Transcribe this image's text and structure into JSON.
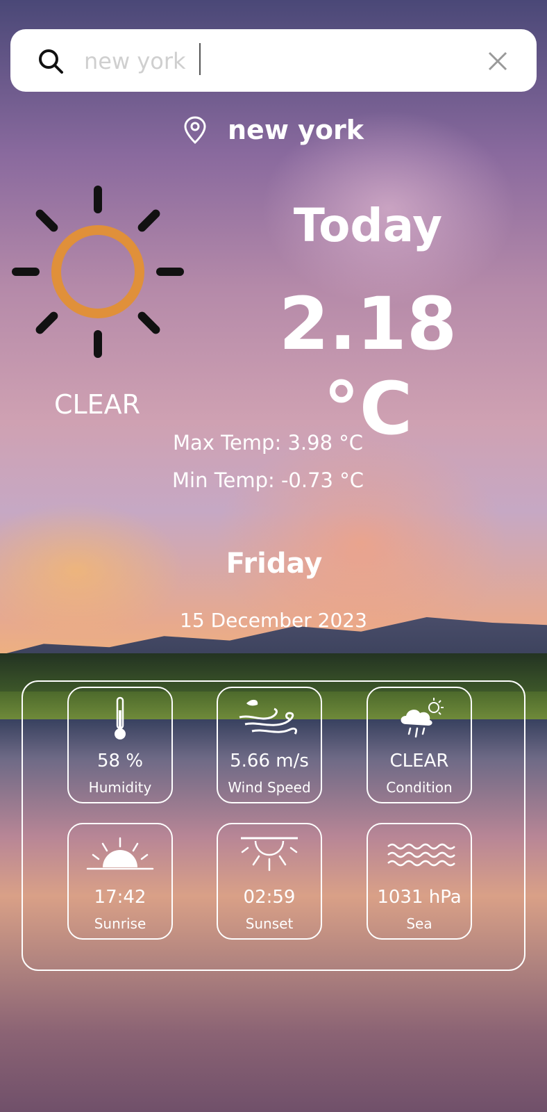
{
  "search": {
    "value": "new york"
  },
  "location": {
    "city": "new york"
  },
  "current": {
    "condition": "CLEAR",
    "heading": "Today",
    "temperature": "2.18 °C",
    "max_temp": "Max Temp: 3.98 °C",
    "min_temp": "Min Temp: -0.73 °C",
    "day": "Friday",
    "date": "15 December 2023"
  },
  "details": [
    {
      "icon": "thermometer-icon",
      "value": "58 %",
      "label": "Humidity"
    },
    {
      "icon": "wind-icon",
      "value": "5.66 m/s",
      "label": "Wind Speed"
    },
    {
      "icon": "weather-condition-icon",
      "value": "CLEAR",
      "label": "Condition"
    },
    {
      "icon": "sunrise-icon",
      "value": "17:42",
      "label": "Sunrise"
    },
    {
      "icon": "sunset-icon",
      "value": "02:59",
      "label": "Sunset"
    },
    {
      "icon": "sea-waves-icon",
      "value": "1031 hPa",
      "label": "Sea"
    }
  ],
  "colors": {
    "sun_circle": "#e0903a",
    "sun_rays": "#111111",
    "search_background": "#ffffff"
  }
}
